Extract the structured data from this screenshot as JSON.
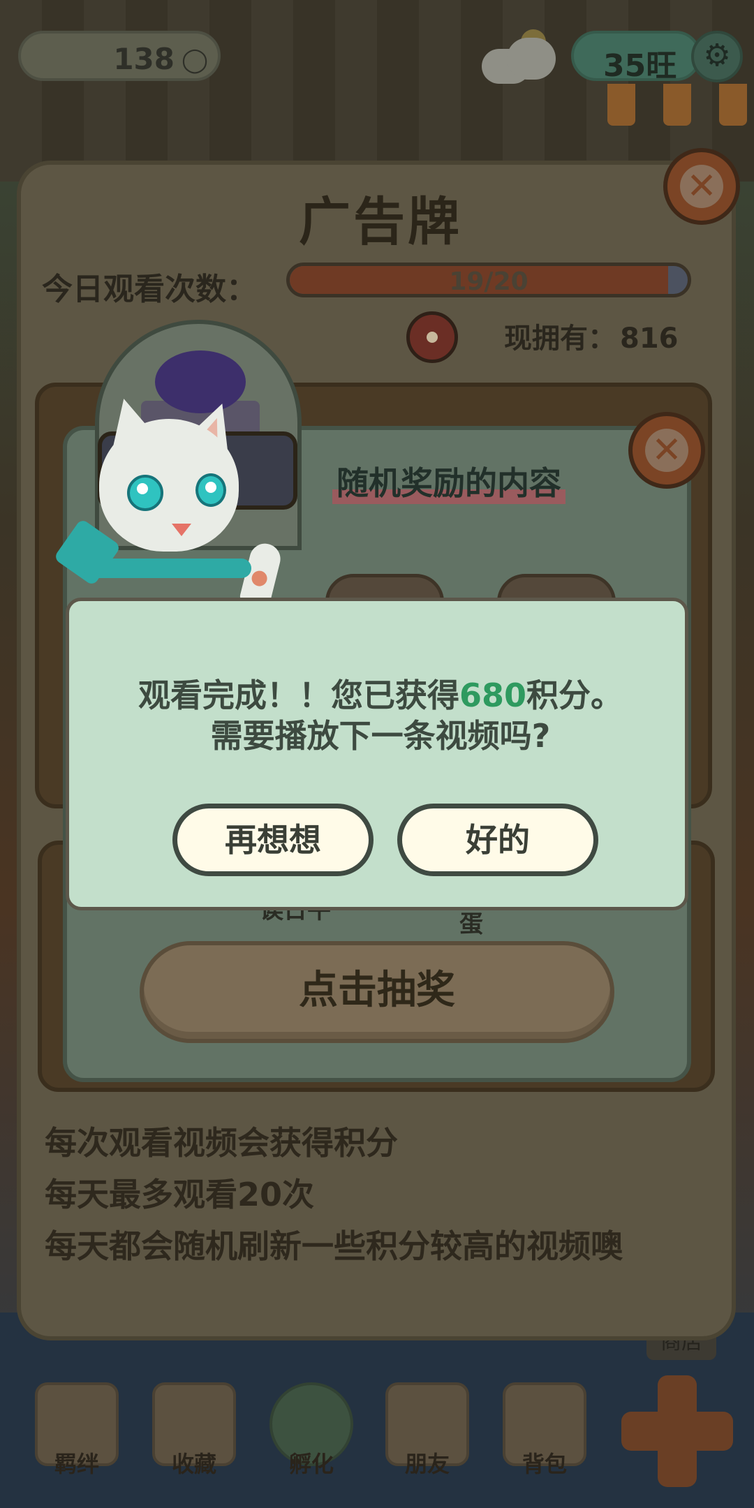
{
  "topbar": {
    "coins": "138",
    "coin_icon": "ingot-icon",
    "wang": "35旺",
    "settings_icon": "gear-icon"
  },
  "panel": {
    "title": "广告牌",
    "watch_label": "今日观看次数：",
    "progress_text": "19/20",
    "progress_fraction": 0.95,
    "owned_label": "现拥有：",
    "owned_value": "816",
    "info_lines": [
      "每次观看视频会获得积分",
      "每天最多观看20次",
      "每天都会随机刷新一些积分较高的视频噢"
    ]
  },
  "reward_dialog": {
    "title": "随机奖励的内容",
    "partial_label_1": "诶日牛",
    "partial_label_2": "蛋",
    "draw_button": "点击抽奖"
  },
  "confirm": {
    "line1_prefix": "观看完成！！您已获得",
    "points": "680",
    "line1_suffix": "积分。",
    "line2": "需要播放下一条视频吗?",
    "cancel_label": "再想想",
    "ok_label": "好的"
  },
  "bottom_nav": {
    "items": [
      "羁绊",
      "收藏",
      "孵化",
      "朋友",
      "背包"
    ],
    "shop_label": "商店"
  }
}
